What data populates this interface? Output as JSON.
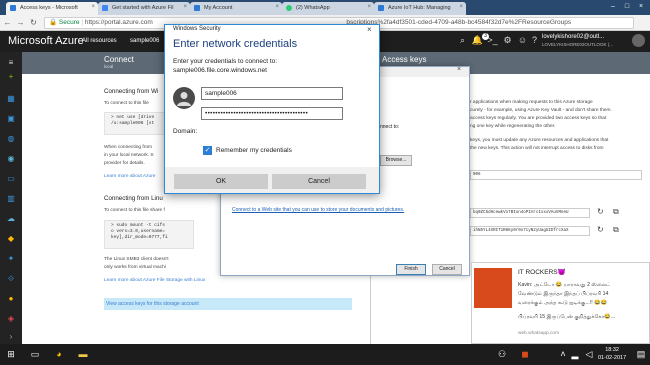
{
  "browser": {
    "tabs": [
      {
        "label": "Access keys - Microsoft",
        "color": "#2c7ad6"
      },
      {
        "label": "Get started with Azure Fil",
        "color": "#4285f4"
      },
      {
        "label": "My Account",
        "color": "#2c7ad6"
      },
      {
        "label": "(2) WhatsApp",
        "color": "#2ecc71"
      },
      {
        "label": "Azure IoT Hub: Managing",
        "color": "#2c7ad6"
      }
    ],
    "secure_label": "Secure",
    "url_start": "https://portal.azure.com",
    "url_end": "bscriptions%2fa4df3501-cded-4709-a48b-bc4584f32d7e%2FResourceGroups"
  },
  "azure": {
    "brand": "Microsoft Azure",
    "all_resources": "All resources",
    "breadcrumb": "sample006",
    "notification_count": "3",
    "account_name": "lovelykishore02@outl...",
    "account_sub": "LOVELYKISHORE02OUTLOOK (..."
  },
  "connect_blade": {
    "title": "Connect",
    "subtitle": "local",
    "section1_heading": "Connecting from Wi",
    "section1_intro": "To connect to this file",
    "code1_line1": "> net use [drive",
    "code1_line2": "/u:sample006 [st",
    "para1_line1": "When connecting from",
    "para1_line2": "in your local network. S",
    "para1_line3": "provider for details.",
    "learn_more_1": "Learn more about Azure",
    "section2_heading": "Connecting from Linu",
    "section2_intro": "To connect to this file share f",
    "code2_line1": "> sudo mount -t cifs",
    "code2_line2": "o vers=3.0,username=",
    "code2_line3": "key],dir_mode=0777,fi",
    "para2_line1": "The Linux SMB3 client doesn't",
    "para2_line2": "only works from virtual machi",
    "learn_more_2": "Learn more about Azure File Storage with Linux",
    "view_keys": "View access keys for this storage account"
  },
  "access_keys_blade": {
    "title": "Access keys",
    "text_lines": [
      "r applications when making requests to this Azure storage",
      "curely - for example, using Azure Key Vault - and don't share them.",
      "access keys regularly. You are provided two access keys so that",
      "ng one key while regenerating the other.",
      "",
      "keys, you must update any Azure resources and applications that",
      "the new keys. This action will not interrupt access to disks from"
    ],
    "storage_name": "006",
    "key1": "bq0ZC5dHcewkVo7BIxn4oPIArcIxxxVAuVMeeU",
    "key2": "ihN5YL4XRIT1R86y0r0o7cyN2yUagUIDfrcXaX"
  },
  "map_dialog": {
    "connect_to_label": "nnect to:",
    "browse_label": "Browse...",
    "storage_link": "Connect to a Web site that you can use to store your documents and pictures.",
    "finish_label": "Finish",
    "cancel_label": "Cancel"
  },
  "windows_security": {
    "window_title": "Windows Security",
    "heading": "Enter network credentials",
    "prompt_line1": "Enter your credentials to connect to:",
    "prompt_line2": "sample006.file.core.windows.net",
    "username": "sample006",
    "password_mask": "••••••••••••••••••••••••••••••••••••••••",
    "domain_label": "Domain:",
    "remember_label": "Remember my credentials",
    "remember_checked": true,
    "ok_label": "OK",
    "cancel_label": "Cancel"
  },
  "whatsapp_toast": {
    "title": "IT ROCKERS😈",
    "line1": "Kavin: அட்டோ 😂 யாராவது 2 ஸ்லைட்",
    "line2": "வேண்டும் இருந்தா இந்தப் பிப்ரவரி 14",
    "line3": "வரைக்கும் அந்த கூடு ஐடிக்கு...!! 😂😂",
    "line4": "பிப்ரவரி 15 இருப்பேன் குறித்துக்கோ😂...",
    "source": "web.whatsapp.com"
  },
  "taskbar": {
    "time": "18:32",
    "date": "01-02-2017"
  }
}
